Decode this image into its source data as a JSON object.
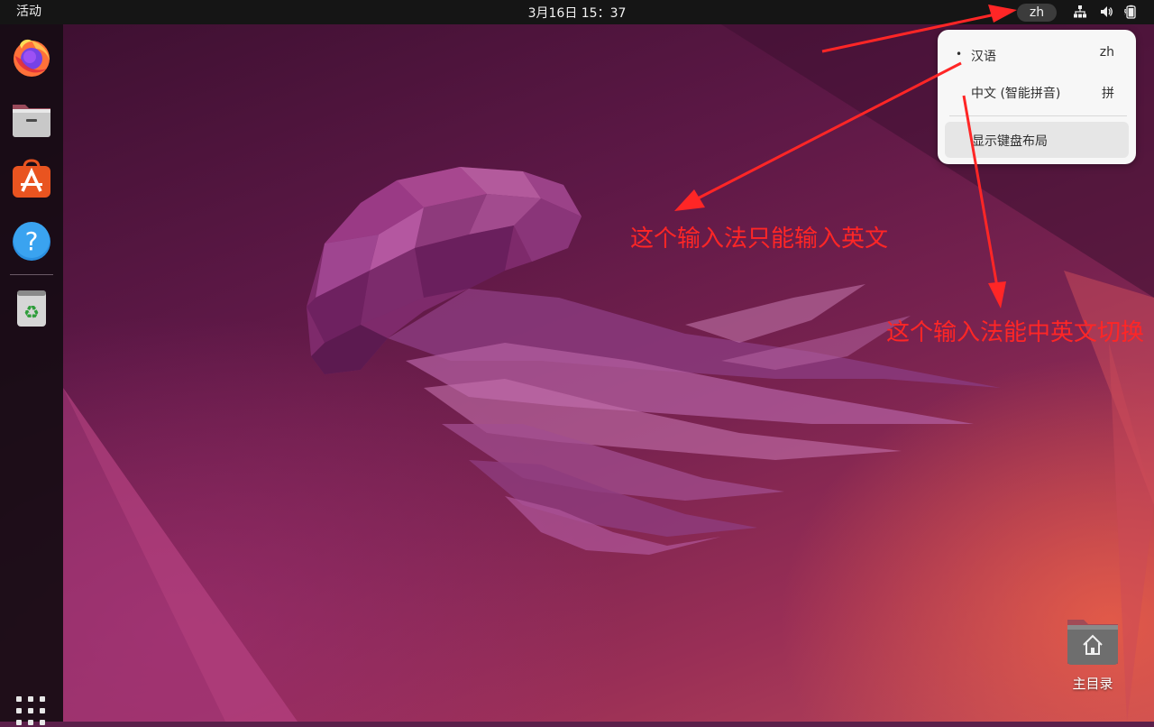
{
  "topbar": {
    "activities_label": "活动",
    "clock": "3月16日  15：37",
    "ime_indicator": "zh",
    "tray_icons": [
      "network-icon",
      "volume-icon",
      "battery-icon"
    ]
  },
  "dock": {
    "items": [
      {
        "name": "Firefox",
        "icon": "firefox-icon"
      },
      {
        "name": "Files",
        "icon": "files-icon"
      },
      {
        "name": "Ubuntu Software",
        "icon": "software-store-icon"
      },
      {
        "name": "Help",
        "icon": "help-icon"
      },
      {
        "name": "Trash",
        "icon": "trash-icon"
      }
    ],
    "apps_grid_icon": "show-apps-icon"
  },
  "ime_menu": {
    "items": [
      {
        "label": "汉语",
        "shortcut": "zh",
        "active": true
      },
      {
        "label": "中文 (智能拼音)",
        "shortcut": "拼",
        "active": false
      }
    ],
    "show_layout_label": "显示键盘布局"
  },
  "annotations": {
    "note_english_only": "这个输入法只能输入英文",
    "note_switch": "这个输入法能中英文切换"
  },
  "desktop": {
    "home_folder_label": "主目录"
  },
  "colors": {
    "annotation": "#ff2626",
    "topbar": "#151515",
    "accent_orange": "#e95420"
  }
}
